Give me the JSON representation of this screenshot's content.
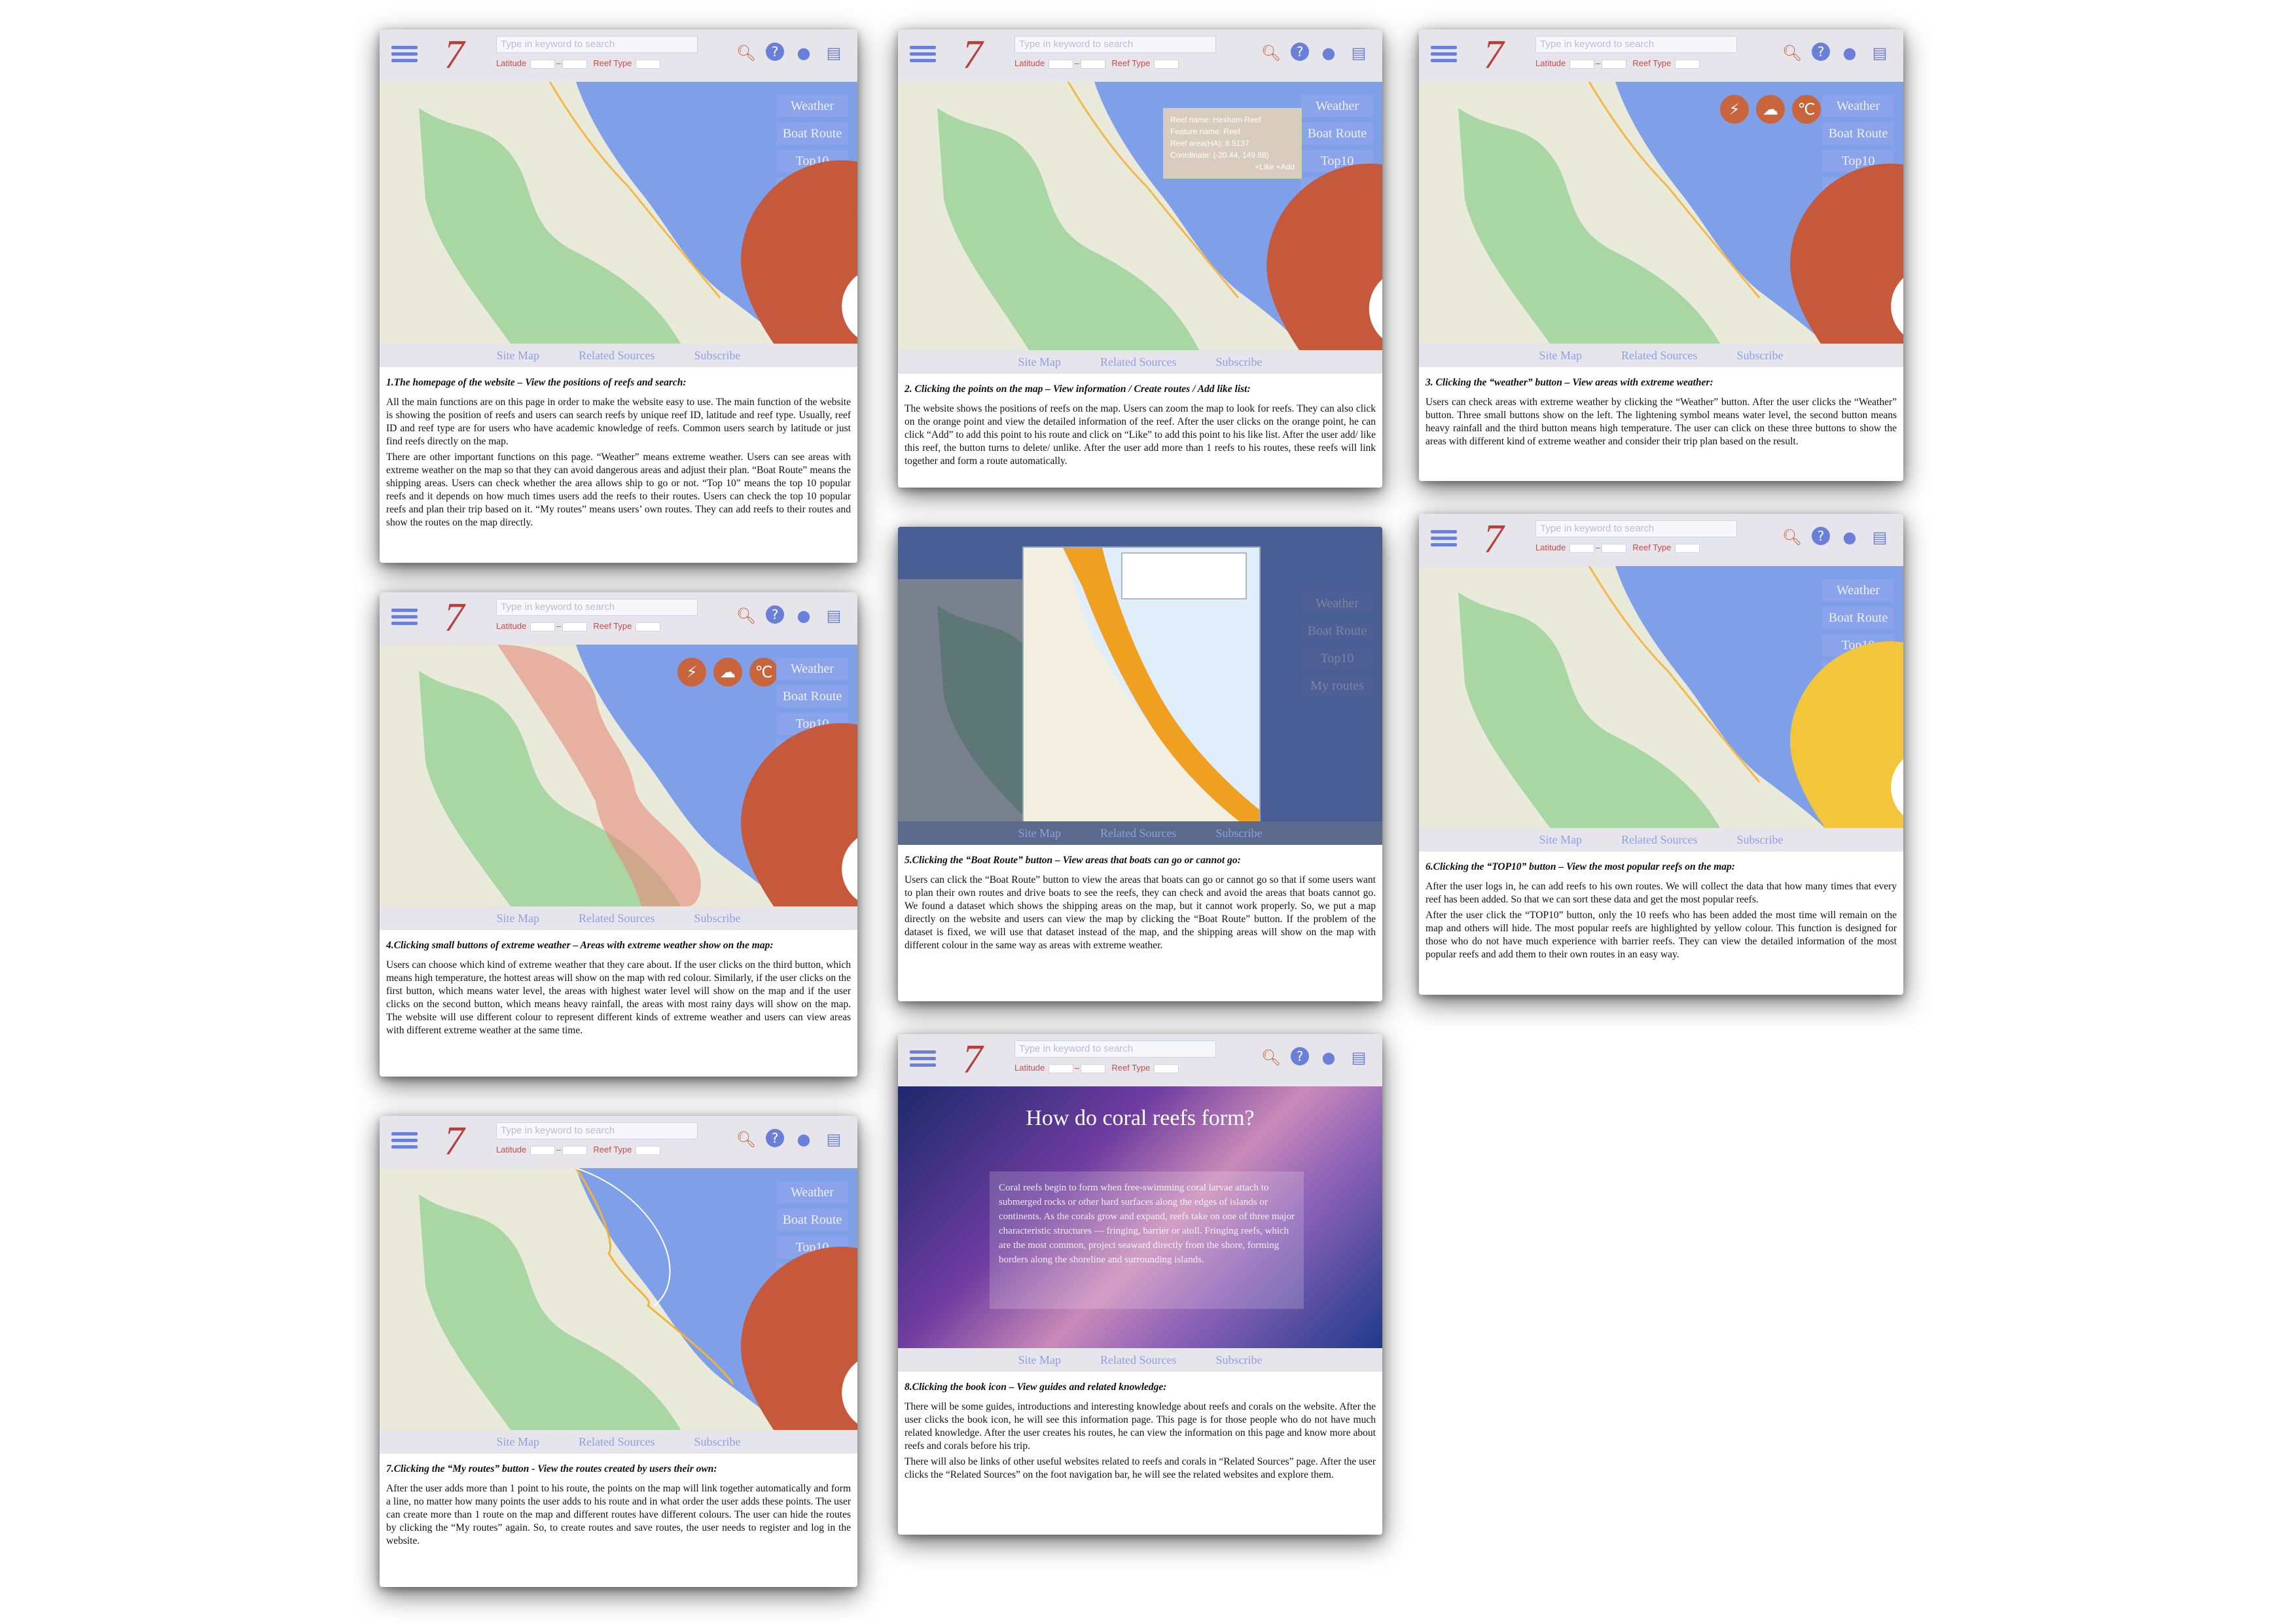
{
  "common": {
    "search_placeholder": "Type in keyword to search",
    "latitude_label": "Latitude",
    "reef_type_label": "Reef Type",
    "map_buttons": [
      "Weather",
      "Boat Route",
      "Top10",
      "My routes"
    ],
    "footer_links": [
      "Site Map",
      "Related Sources",
      "Subscribe"
    ],
    "logo_text": "7"
  },
  "panels": [
    {
      "caption_title": "1.The homepage of the website – View the positions of reefs and search:",
      "caption_body": [
        "All the main functions are on this page in order to make the website easy to use. The main function of the website is showing the position of reefs and users can search reefs by unique reef ID, latitude and reef type. Usually, reef ID and reef type are for users who have academic knowledge of reefs. Common users search by latitude or just find reefs directly on the map.",
        "There are other important functions on this page. “Weather” means extreme weather. Users can see areas with extreme weather on the map so that they can avoid dangerous areas and adjust their plan. “Boat Route” means the shipping areas. Users can check whether the area allows ship to go or not. “Top 10” means the top 10 popular reefs and it depends on how much times users add the reefs to their routes. Users can check the top 10 popular reefs and plan their trip based on it. “My routes” means users’ own routes. They can add reefs to their routes and show the routes on the map directly."
      ]
    },
    {
      "popup": [
        "Reef name: Hexham Reef",
        "Feature name: Reef",
        "Reef area(HA): 8.5137",
        "Coordinate: (-20.44, 149.88)",
        "+Like     +Add"
      ],
      "caption_title": "2. Clicking the points on the map – View information / Create routes / Add like list:",
      "caption_body": [
        "The website shows the positions of reefs on the map. Users can zoom the map to look for reefs. They can also click on the orange point and view the detailed information of the reef. After the user clicks on the orange point, he can click “Add” to add this point to his route and click on “Like” to add this point to his like list. After the user add/ like this reef, the button turns to delete/ unlike. After the user add more than 1 reefs to his routes, these reefs will link together and form a route automatically."
      ]
    },
    {
      "caption_title": "3. Clicking the “weather” button – View areas with extreme weather:",
      "caption_body": [
        "Users can check areas with extreme weather by clicking the “Weather” button. After the user clicks the “Weather” button. Three small buttons show on the left. The lightening symbol means water level, the second button means heavy rainfall and the third button means high temperature. The user can click on these three buttons to show the areas with different kind of extreme weather and consider their trip plan based on the result."
      ]
    },
    {
      "caption_title": "4.Clicking small buttons of extreme weather – Areas with extreme weather show on the map:",
      "caption_body": [
        "Users can choose which kind of extreme weather that they care about. If the user clicks on the third button, which means high temperature, the hottest areas will show on the map with red colour. Similarly, if the user clicks on the first button, which means water level, the areas with highest water level will show on the map and if the user clicks on the second button, which means heavy rainfall, the areas with most rainy days will show on the map. The website will use different colour to represent different kinds of extreme weather and users can view areas with different extreme weather at the same time."
      ]
    },
    {
      "caption_title": "5.Clicking the “Boat Route” button – View areas that boats can go or cannot go:",
      "caption_body": [
        "Users can click the “Boat Route” button to view the areas that boats can go or cannot go so that if some users want to plan their own routes and drive boats to see the reefs, they can check and avoid the areas that boats cannot go. We found a dataset which shows the shipping areas on the map, but it cannot work properly. So, we put a map directly on the website and users can view the map by clicking the “Boat Route” button. If the problem of the dataset is fixed, we will use that dataset instead of the map, and the shipping areas will show on the map with different colour in the same way as areas with extreme weather."
      ]
    },
    {
      "caption_title": "6.Clicking the “TOP10” button – View the most popular reefs on the map:",
      "caption_body": [
        "After the user logs in, he can add reefs to his own routes. We will collect the data that how many times that every reef has been added. So that we can sort these data and get the most popular reefs.",
        "After the user click the “TOP10” button, only the 10 reefs who has been added the most time will remain on the map and others will hide. The most popular reefs are highlighted by yellow colour. This function is designed for those who do not have much experience with barrier reefs. They can view the detailed information of the most popular reefs and add them to their own routes in an easy way."
      ]
    },
    {
      "caption_title": "7.Clicking the “My routes” button - View the routes created by users their own:",
      "caption_body": [
        "After the user adds more than 1 point to his route, the points on the map will link together automatically and form a line, no matter how many points the user adds to his route and in what order the user adds these points. The user can create more than 1 route on the map and different routes have different colours. The user can hide the routes by clicking the “My routes” again. So, to create routes and save routes, the user needs to register and log in the website."
      ]
    },
    {
      "book_title": "How do coral reefs form?",
      "book_text": "Coral reefs begin to form when free-swimming coral larvae attach to submerged rocks or other hard surfaces along the edges of islands or continents. As the corals grow and expand, reefs take on one of three major characteristic structures — fringing, barrier or atoll. Fringing reefs, which are the most common, project seaward directly from the shore, forming borders along the shoreline and surrounding islands.",
      "caption_title": "8.Clicking the book icon – View guides and related knowledge:",
      "caption_body": [
        "There will be some guides, introductions and interesting knowledge about reefs and corals on the website. After the user clicks the book icon, he will see this information page. This page is for those people who do not have much related knowledge. After the user creates his routes, he can view the information on this page and know more about reefs and corals before his trip.",
        "There will also be links of other useful websites related to reefs and corals in “Related Sources” page. After the user clicks the “Related Sources” on the foot navigation bar, he will see the related websites and explore them."
      ]
    }
  ]
}
